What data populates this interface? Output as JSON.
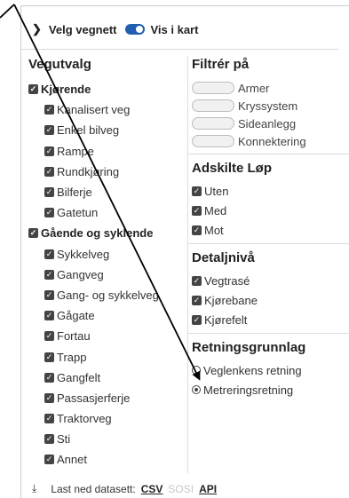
{
  "header": {
    "title": "Velg vegnett",
    "toggle_label": "Vis i kart"
  },
  "left": {
    "heading": "Vegutvalg",
    "groups": [
      {
        "label": "Kjørende",
        "items": [
          "Kanalisert veg",
          "Enkel bilveg",
          "Rampe",
          "Rundkjøring",
          "Bilferje",
          "Gatetun"
        ]
      },
      {
        "label": "Gående og syklende",
        "items": [
          "Sykkelveg",
          "Gangveg",
          "Gang- og sykkelveg",
          "Gågate",
          "Fortau",
          "Trapp",
          "Gangfelt",
          "Passasjerferje",
          "Traktorveg",
          "Sti",
          "Annet"
        ]
      }
    ]
  },
  "right": {
    "filter_heading": "Filtrér på",
    "filters": [
      "Armer",
      "Kryssystem",
      "Sideanlegg",
      "Konnektering"
    ],
    "adskilte_heading": "Adskilte Løp",
    "adskilte": [
      "Uten",
      "Med",
      "Mot"
    ],
    "detalj_heading": "Detaljnivå",
    "detalj": [
      "Vegtrasé",
      "Kjørebane",
      "Kjørefelt"
    ],
    "retning_heading": "Retningsgrunnlag",
    "retning": [
      {
        "label": "Veglenkens retning",
        "selected": false
      },
      {
        "label": "Metreringsretning",
        "selected": true
      }
    ]
  },
  "footer": {
    "label": "Last ned datasett:",
    "csv": "CSV",
    "sosi": "SOSI",
    "api": "API"
  },
  "colors": {
    "toggle": "#1f5fb0",
    "arrow": "#000000"
  }
}
